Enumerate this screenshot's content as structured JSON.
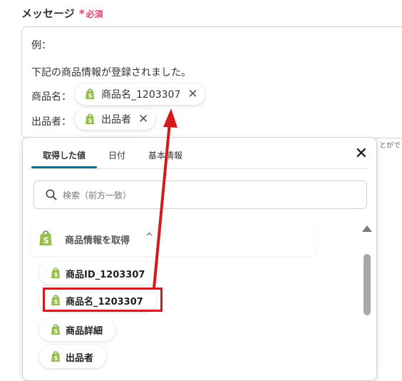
{
  "field": {
    "label": "メッセージ",
    "asterisk": "*",
    "required": "必須"
  },
  "message": {
    "example_prefix": "例：",
    "body_line": "下記の商品情報が登録されました。",
    "row1_label": "商品名：",
    "row1_chip": "商品名_1203307",
    "row2_label": "出品者：",
    "row2_chip": "出品者"
  },
  "side_hint": "とがで",
  "popover": {
    "tabs": [
      "取得した値",
      "日付",
      "基本情報"
    ],
    "active_tab": "取得した値",
    "close_glyph": "✕",
    "search_placeholder": "検索（前方一致）",
    "group_title": "商品情報を取得",
    "group_chevron": "^",
    "items": [
      "商品ID_1203307",
      "商品名_1203307",
      "商品詳細",
      "出品者"
    ]
  },
  "colors": {
    "accent_tab": "#0d6e86",
    "required_red": "#e8436a",
    "annotation_red": "#d6191f",
    "shopify_green": "#95bf47"
  },
  "icons": {
    "chip_icon": "shopify-bag-icon",
    "close_icon": "close-icon",
    "search_icon": "search-icon"
  }
}
